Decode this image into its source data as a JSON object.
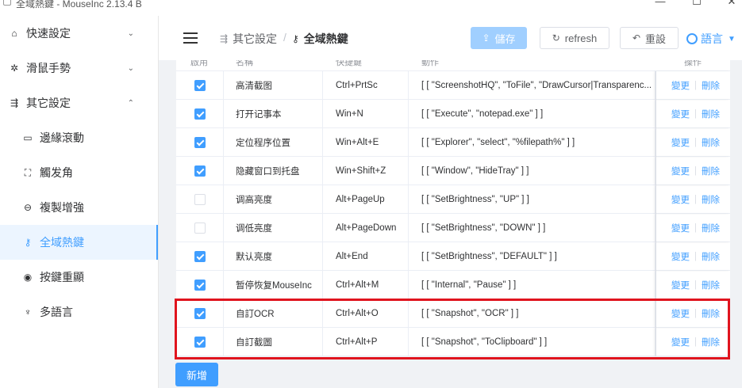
{
  "window": {
    "title": "全域熱鍵 - MouseInc 2.13.4 B",
    "min": "—",
    "max": "☐",
    "close": "✕"
  },
  "sidebar": {
    "items": [
      {
        "label": "快速設定",
        "icon": "home-icon",
        "glyph": "⌂",
        "chevron": "⌄"
      },
      {
        "label": "滑鼠手勢",
        "icon": "gear-icon",
        "glyph": "✲",
        "chevron": "⌄"
      },
      {
        "label": "其它設定",
        "icon": "sliders-icon",
        "glyph": "⇶",
        "chevron": "⌃"
      },
      {
        "label": "邊緣滾動",
        "icon": "monitor-icon",
        "glyph": "▭"
      },
      {
        "label": "觸发角",
        "icon": "fullscreen-icon",
        "glyph": "⛶"
      },
      {
        "label": "複製增強",
        "icon": "link-icon",
        "glyph": "⊖"
      },
      {
        "label": "全域熱鍵",
        "icon": "key-icon",
        "glyph": "⚷"
      },
      {
        "label": "按鍵重顯",
        "icon": "eye-icon",
        "glyph": "◉"
      },
      {
        "label": "多語言",
        "icon": "microphone-icon",
        "glyph": "♆"
      }
    ]
  },
  "header": {
    "breadcrumb_parent": "其它設定",
    "breadcrumb_current": "全域熱鍵",
    "breadcrumb_sep": "/",
    "save_label": "儲存",
    "refresh_label": "refresh",
    "reset_label": "重設",
    "language_label": "語言"
  },
  "table": {
    "columns": [
      "啟用",
      "名稱",
      "快捷鍵",
      "動作",
      "操作"
    ],
    "edit_label": "變更",
    "delete_label": "刪除",
    "rows": [
      {
        "enabled": true,
        "name": "高清截图",
        "key": "Ctrl+PrtSc",
        "action": "[ [ \"ScreenshotHQ\", \"ToFile\", \"DrawCursor|Transparenc..."
      },
      {
        "enabled": true,
        "name": "打开记事本",
        "key": "Win+N",
        "action": "[ [ \"Execute\", \"notepad.exe\" ] ]"
      },
      {
        "enabled": true,
        "name": "定位程序位置",
        "key": "Win+Alt+E",
        "action": "[ [ \"Explorer\", \"select\", \"%filepath%\" ] ]"
      },
      {
        "enabled": true,
        "name": "隐藏窗口到托盘",
        "key": "Win+Shift+Z",
        "action": "[ [ \"Window\", \"HideTray\" ] ]"
      },
      {
        "enabled": false,
        "name": "调高亮度",
        "key": "Alt+PageUp",
        "action": "[ [ \"SetBrightness\", \"UP\" ] ]"
      },
      {
        "enabled": false,
        "name": "调低亮度",
        "key": "Alt+PageDown",
        "action": "[ [ \"SetBrightness\", \"DOWN\" ] ]"
      },
      {
        "enabled": true,
        "name": "默认亮度",
        "key": "Alt+End",
        "action": "[ [ \"SetBrightness\", \"DEFAULT\" ] ]"
      },
      {
        "enabled": true,
        "name": "暂停恢复MouseInc",
        "key": "Ctrl+Alt+M",
        "action": "[ [ \"Internal\", \"Pause\" ] ]"
      },
      {
        "enabled": true,
        "name": "自訂OCR",
        "key": "Ctrl+Alt+O",
        "action": "[ [ \"Snapshot\", \"OCR\" ] ]"
      },
      {
        "enabled": true,
        "name": "自訂截圖",
        "key": "Ctrl+Alt+P",
        "action": "[ [ \"Snapshot\", \"ToClipboard\" ] ]"
      }
    ]
  },
  "add_label": "新增",
  "colors": {
    "accent": "#409eff",
    "highlight": "#e0141e",
    "background": "#f0f2f5"
  }
}
